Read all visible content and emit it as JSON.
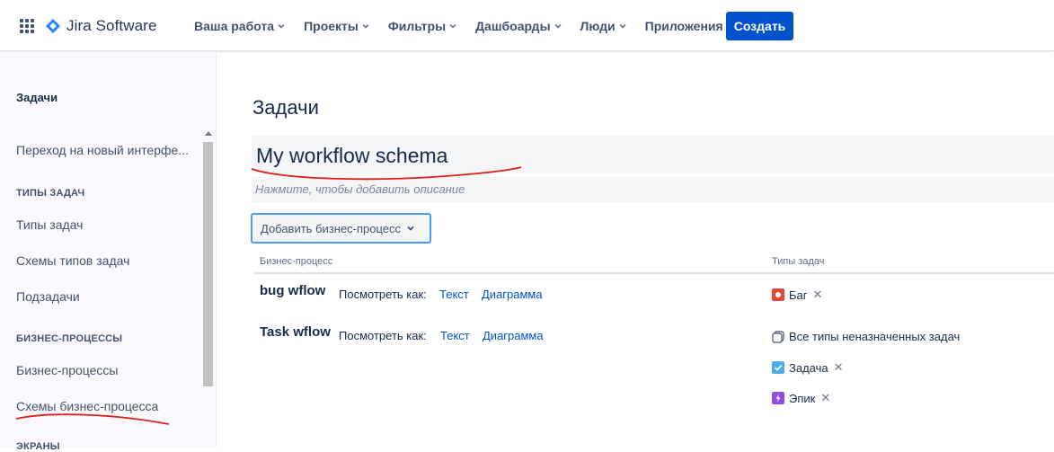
{
  "topbar": {
    "app_name": "Jira Software",
    "nav": [
      "Ваша работа",
      "Проекты",
      "Фильтры",
      "Дашбоарды",
      "Люди",
      "Приложения"
    ],
    "create_label": "Создать"
  },
  "sidebar": {
    "title": "Задачи",
    "new_interface": "Переход на новый интерфе...",
    "section_issue_types": "ТИПЫ ЗАДАЧ",
    "issue_types": "Типы задач",
    "issue_type_schemes": "Схемы типов задач",
    "subtasks": "Подзадачи",
    "section_workflows": "БИЗНЕС-ПРОЦЕССЫ",
    "workflows": "Бизнес-процессы",
    "workflow_schemes": "Схемы бизнес-процесса",
    "section_screens": "ЭКРАНЫ"
  },
  "main": {
    "page_title": "Задачи",
    "scheme_name": "My workflow schema",
    "description_placeholder": "Нажмите, чтобы добавить описание",
    "add_workflow_label": "Добавить бизнес-процесс",
    "col_workflow": "Бизнес-процесс",
    "col_issue_types": "Типы задач",
    "view_as": "Посмотреть как:",
    "text_link": "Текст",
    "diagram_link": "Диаграмма",
    "workflows": [
      {
        "name": "bug wflow",
        "issue_types": [
          {
            "label": "Баг",
            "icon": "bug-icon",
            "color": "#e5493a"
          }
        ]
      },
      {
        "name": "Task wflow",
        "issue_types": [
          {
            "label": "Все типы неназначенных задач",
            "icon": "unassigned-types-icon",
            "color": "#ffffff"
          },
          {
            "label": "Задача",
            "icon": "task-icon",
            "color": "#4bade8"
          },
          {
            "label": "Эпик",
            "icon": "epic-icon",
            "color": "#904ee2"
          }
        ]
      }
    ]
  },
  "colors": {
    "primary": "#0052cc",
    "focus_border": "#4c9aff",
    "annotation": "#e0201b"
  }
}
